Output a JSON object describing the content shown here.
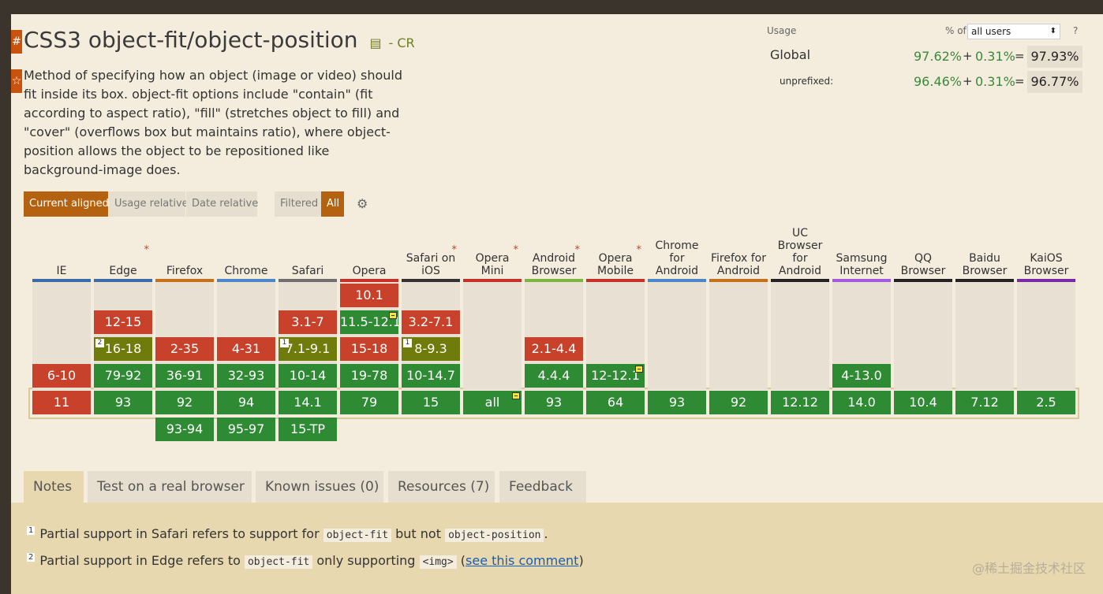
{
  "side_tabs": [
    "#",
    "☆"
  ],
  "title": "CSS3 object-fit/object-position",
  "doc_icon": "document-icon",
  "status": "- CR",
  "description": "Method of specifying how an object (image or video) should fit inside its box. object-fit options include \"contain\" (fit according to aspect ratio), \"fill\" (stretches object to fill) and \"cover\" (overflows box but maintains ratio), where object-position allows the object to be repositioned like background-image does.",
  "usage": {
    "label": "Usage",
    "pct_of_label": "% of",
    "select_value": "all users",
    "help": "?",
    "global": {
      "label": "Global",
      "a": "97.62%",
      "plus": "+",
      "b": "0.31%",
      "eq": "=",
      "total": "97.93%"
    },
    "unprefixed": {
      "label": "unprefixed:",
      "a": "96.46%",
      "plus": "+",
      "b": "0.31%",
      "eq": "=",
      "total": "96.77%"
    }
  },
  "controls": {
    "current_aligned": "Current aligned",
    "usage_relative": "Usage relative",
    "date_relative": "Date relative",
    "filtered": "Filtered",
    "all": "All"
  },
  "browsers": [
    {
      "name": "IE",
      "star": "",
      "color": "#3d6aa8"
    },
    {
      "name": "Edge",
      "star": "*",
      "color": "#3d6aa8"
    },
    {
      "name": "Firefox",
      "star": "",
      "color": "#c6701c"
    },
    {
      "name": "Chrome",
      "star": "",
      "color": "#4a86c8"
    },
    {
      "name": "Safari",
      "star": "",
      "color": "#6f6f6f"
    },
    {
      "name": "Opera",
      "star": "",
      "color": "#c8302a"
    },
    {
      "name": "Safari on iOS",
      "star": "*",
      "color": "#333333"
    },
    {
      "name": "Opera Mini",
      "star": "*",
      "color": "#c8302a"
    },
    {
      "name": "Android Browser",
      "star": "*",
      "color": "#7bb540"
    },
    {
      "name": "Opera Mobile",
      "star": "*",
      "color": "#c8302a"
    },
    {
      "name": "Chrome for Android",
      "star": "",
      "color": "#4a86c8"
    },
    {
      "name": "Firefox for Android",
      "star": "",
      "color": "#c6701c"
    },
    {
      "name": "UC Browser for Android",
      "star": "",
      "color": "#222222"
    },
    {
      "name": "Samsung Internet",
      "star": "",
      "color": "#a05ae0"
    },
    {
      "name": "QQ Browser",
      "star": "",
      "color": "#222222"
    },
    {
      "name": "Baidu Browser",
      "star": "",
      "color": "#222222"
    },
    {
      "name": "KaiOS Browser",
      "star": "",
      "color": "#7a2aa8"
    }
  ],
  "support": [
    {
      "col": 5,
      "row": 0,
      "text": "10.1",
      "state": "n"
    },
    {
      "col": 1,
      "row": 1,
      "text": "12-15",
      "state": "n"
    },
    {
      "col": 4,
      "row": 1,
      "text": "3.1-7",
      "state": "n"
    },
    {
      "col": 5,
      "row": 1,
      "text": "11.5-12.1",
      "state": "y",
      "prefix": true
    },
    {
      "col": 6,
      "row": 1,
      "text": "3.2-7.1",
      "state": "n"
    },
    {
      "col": 1,
      "row": 2,
      "text": "16-18",
      "state": "a",
      "note": "2"
    },
    {
      "col": 2,
      "row": 2,
      "text": "2-35",
      "state": "n"
    },
    {
      "col": 3,
      "row": 2,
      "text": "4-31",
      "state": "n"
    },
    {
      "col": 4,
      "row": 2,
      "text": "7.1-9.1",
      "state": "a",
      "note": "1"
    },
    {
      "col": 5,
      "row": 2,
      "text": "15-18",
      "state": "n"
    },
    {
      "col": 6,
      "row": 2,
      "text": "8-9.3",
      "state": "a",
      "note": "1"
    },
    {
      "col": 8,
      "row": 2,
      "text": "2.1-4.4",
      "state": "n"
    },
    {
      "col": 0,
      "row": 3,
      "text": "6-10",
      "state": "n"
    },
    {
      "col": 1,
      "row": 3,
      "text": "79-92",
      "state": "y"
    },
    {
      "col": 2,
      "row": 3,
      "text": "36-91",
      "state": "y"
    },
    {
      "col": 3,
      "row": 3,
      "text": "32-93",
      "state": "y"
    },
    {
      "col": 4,
      "row": 3,
      "text": "10-14",
      "state": "y"
    },
    {
      "col": 5,
      "row": 3,
      "text": "19-78",
      "state": "y"
    },
    {
      "col": 6,
      "row": 3,
      "text": "10-14.7",
      "state": "y"
    },
    {
      "col": 8,
      "row": 3,
      "text": "4.4.4",
      "state": "y"
    },
    {
      "col": 9,
      "row": 3,
      "text": "12-12.1",
      "state": "y",
      "prefix": true
    },
    {
      "col": 13,
      "row": 3,
      "text": "4-13.0",
      "state": "y"
    },
    {
      "col": 0,
      "row": 4,
      "text": "11",
      "state": "n"
    },
    {
      "col": 1,
      "row": 4,
      "text": "93",
      "state": "y"
    },
    {
      "col": 2,
      "row": 4,
      "text": "92",
      "state": "y"
    },
    {
      "col": 3,
      "row": 4,
      "text": "94",
      "state": "y"
    },
    {
      "col": 4,
      "row": 4,
      "text": "14.1",
      "state": "y"
    },
    {
      "col": 5,
      "row": 4,
      "text": "79",
      "state": "y"
    },
    {
      "col": 6,
      "row": 4,
      "text": "15",
      "state": "y"
    },
    {
      "col": 7,
      "row": 4,
      "text": "all",
      "state": "y",
      "prefix": true
    },
    {
      "col": 8,
      "row": 4,
      "text": "93",
      "state": "y"
    },
    {
      "col": 9,
      "row": 4,
      "text": "64",
      "state": "y"
    },
    {
      "col": 10,
      "row": 4,
      "text": "93",
      "state": "y"
    },
    {
      "col": 11,
      "row": 4,
      "text": "92",
      "state": "y"
    },
    {
      "col": 12,
      "row": 4,
      "text": "12.12",
      "state": "y"
    },
    {
      "col": 13,
      "row": 4,
      "text": "14.0",
      "state": "y"
    },
    {
      "col": 14,
      "row": 4,
      "text": "10.4",
      "state": "y"
    },
    {
      "col": 15,
      "row": 4,
      "text": "7.12",
      "state": "y"
    },
    {
      "col": 16,
      "row": 4,
      "text": "2.5",
      "state": "y"
    },
    {
      "col": 2,
      "row": 5,
      "text": "93-94",
      "state": "y"
    },
    {
      "col": 3,
      "row": 5,
      "text": "95-97",
      "state": "y"
    },
    {
      "col": 4,
      "row": 5,
      "text": "15-TP",
      "state": "y"
    }
  ],
  "tabs": [
    "Notes",
    "Test on a real browser",
    "Known issues (0)",
    "Resources (7)",
    "Feedback"
  ],
  "notes": {
    "n1": {
      "num": "1",
      "pre": "Partial support in Safari refers to support for",
      "code1": "object-fit",
      "mid": "but not",
      "code2": "object-position",
      "post": "."
    },
    "n2": {
      "num": "2",
      "pre": "Partial support in Edge refers to",
      "code1": "object-fit",
      "mid": "only supporting",
      "code2": "<img>",
      "link_open": "(",
      "link": "see this comment",
      "link_close": ")"
    }
  },
  "watermark": "@稀土掘金技术社区"
}
